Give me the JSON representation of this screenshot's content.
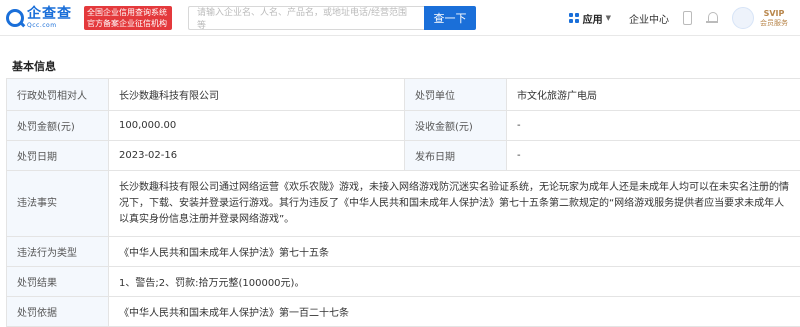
{
  "header": {
    "logo_cn": "企查查",
    "logo_en": "Qcc.com",
    "badge_line1": "全国企业信用查询系统",
    "badge_line2": "官方备案企业征信机构",
    "search_placeholder": "请输入企业名、人名、产品名，或地址电话/经营范围等",
    "search_button": "查一下",
    "apps_label": "应用",
    "enterprise_center": "企业中心",
    "svip_label": "SVIP",
    "member_service": "会员服务"
  },
  "section": {
    "title": "基本信息"
  },
  "details": {
    "party_label": "行政处罚相对人",
    "party_value": "长沙数趣科技有限公司",
    "unit_label": "处罚单位",
    "unit_value": "市文化旅游广电局",
    "amount_label": "处罚金额(元)",
    "amount_value": "100,000.00",
    "confiscation_label": "没收金额(元)",
    "confiscation_value": "-",
    "date_label": "处罚日期",
    "date_value": "2023-02-16",
    "publish_label": "发布日期",
    "publish_value": "-",
    "facts_label": "违法事实",
    "facts_value": "长沙数趣科技有限公司通过网络运营《欢乐农陇》游戏，未接入网络游戏防沉迷实名验证系统，无论玩家为成年人还是未成年人均可以在未实名注册的情况下，下载、安装并登录运行游戏。其行为违反了《中华人民共和国未成年人保护法》第七十五条第二款规定的“网络游戏服务提供者应当要求未成年人以真实身份信息注册并登录网络游戏”。",
    "type_label": "违法行为类型",
    "type_value": "《中华人民共和国未成年人保护法》第七十五条",
    "result_label": "处罚结果",
    "result_value": "1、警告;2、罚款:拾万元整(100000元)。",
    "basis_label": "处罚依据",
    "basis_value": "《中华人民共和国未成年人保护法》第一百二十七条"
  }
}
